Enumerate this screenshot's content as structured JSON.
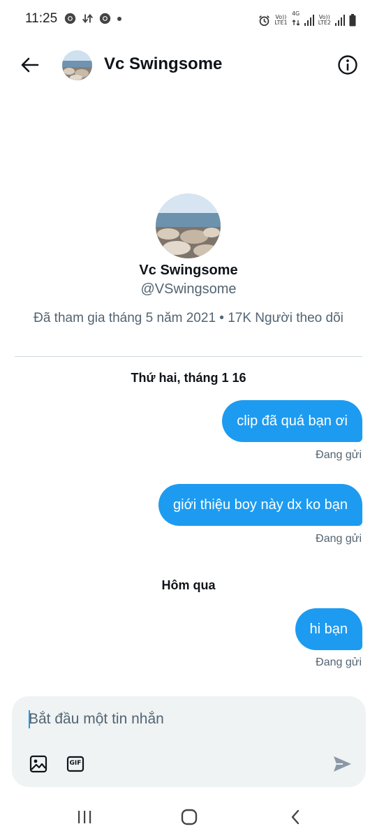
{
  "status_bar": {
    "time": "11:25",
    "sim1_top": "Vo))",
    "sim1_bottom": "LTE1",
    "net_type": "4G",
    "sim2_top": "Vo))",
    "sim2_bottom": "LTE2"
  },
  "header": {
    "title": "Vc Swingsome",
    "back_icon": "arrow-left-icon",
    "info_icon": "info-circle-icon"
  },
  "profile": {
    "name": "Vc Swingsome",
    "handle": "@VSwingsome",
    "meta": "Đã tham gia tháng 5 năm 2021 • 17K Người theo dõi"
  },
  "conversation": {
    "groups": [
      {
        "date": "Thứ hai, tháng 1 16",
        "messages": [
          {
            "text": "clip đã quá bạn ơi",
            "status": "Đang gửi"
          },
          {
            "text": "giới thiệu boy này dx ko bạn",
            "status": "Đang gửi"
          }
        ]
      },
      {
        "date": "Hôm qua",
        "messages": [
          {
            "text": "hi bạn",
            "status": "Đang gửi"
          }
        ]
      }
    ]
  },
  "composer": {
    "placeholder": "Bắt đầu một tin nhắn",
    "value": "",
    "gif_label": "GIF"
  },
  "colors": {
    "accent": "#1d9bf0",
    "secondary_text": "#536471",
    "composer_bg": "#eff3f4"
  }
}
